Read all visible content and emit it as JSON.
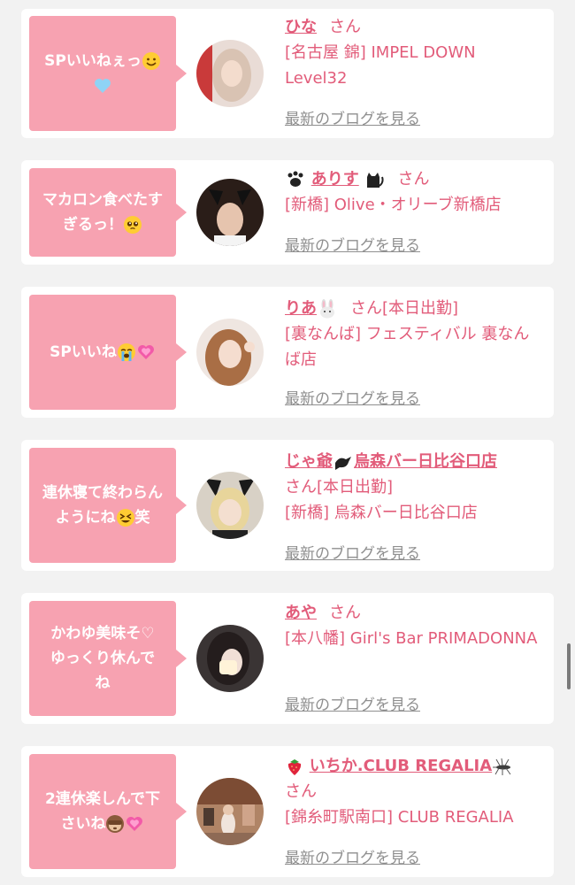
{
  "posts": [
    {
      "message": "SPいいねぇっ",
      "message_emoji": [
        "smiling-face-emoji",
        "light-blue-heart-emoji"
      ],
      "name": "ひな",
      "name_emoji": [],
      "honorific": "さん",
      "status": "",
      "shop": "[名古屋 錦] IMPEL DOWN Level32",
      "blog_link": "最新のブログを見る"
    },
    {
      "message": "マカロン食べたすぎるっ！",
      "message_emoji": [
        "pleading-face-emoji"
      ],
      "name": "ありす",
      "name_emoji": [
        "paw-prints-emoji",
        "black-cat-emoji"
      ],
      "honorific": "さん",
      "status": "",
      "shop": "[新橋] Olive・オリーブ新橋店",
      "blog_link": "最新のブログを見る"
    },
    {
      "message": "SPいいね",
      "message_emoji": [
        "loudly-crying-face-emoji",
        "growing-heart-emoji"
      ],
      "name": "りあ",
      "name_emoji": [
        "rabbit-face-emoji"
      ],
      "honorific": "さん",
      "status": "[本日出勤]",
      "shop": "[裏なんば] フェスティバル 裏なんば店",
      "blog_link": "最新のブログを見る"
    },
    {
      "message_line1": "連休寝て終わらん",
      "message_line2": "ようにね",
      "message_suffix": "笑",
      "message_emoji": [
        "laughing-squint-face-emoji"
      ],
      "name_part1": "じゃ爺",
      "name_part2": "烏森バー日比谷口店",
      "name_emoji": [
        "black-bird-emoji"
      ],
      "honorific": "さん",
      "status": "[本日出勤]",
      "shop": "[新橋] 烏森バー日比谷口店",
      "blog_link": "最新のブログを見る"
    },
    {
      "message": "かわゆ美味そ♡ゆっくり休んでね",
      "message_emoji": [],
      "name": "あや",
      "name_emoji": [],
      "honorific": "さん",
      "status": "",
      "shop": "[本八幡] Girl's Bar PRIMADONNA",
      "blog_link": "最新のブログを見る"
    },
    {
      "message_line1": "2連休楽しんで下",
      "message_line2": "さいね",
      "message_emoji": [
        "see-no-evil-monkey-emoji",
        "growing-heart-emoji"
      ],
      "name": "いちか.CLUB REGALIA",
      "name_emoji": [
        "strawberry-emoji",
        "mosquito-emoji"
      ],
      "honorific": "さん",
      "status": "",
      "shop": "[錦糸町駅南口] CLUB REGALIA",
      "blog_link": "最新のブログを見る"
    }
  ],
  "colors": {
    "background": "#f2f2f2",
    "bubble": "#f7a2b1",
    "accent_text": "#e25c7a",
    "link_grey": "#8f8f8f"
  }
}
